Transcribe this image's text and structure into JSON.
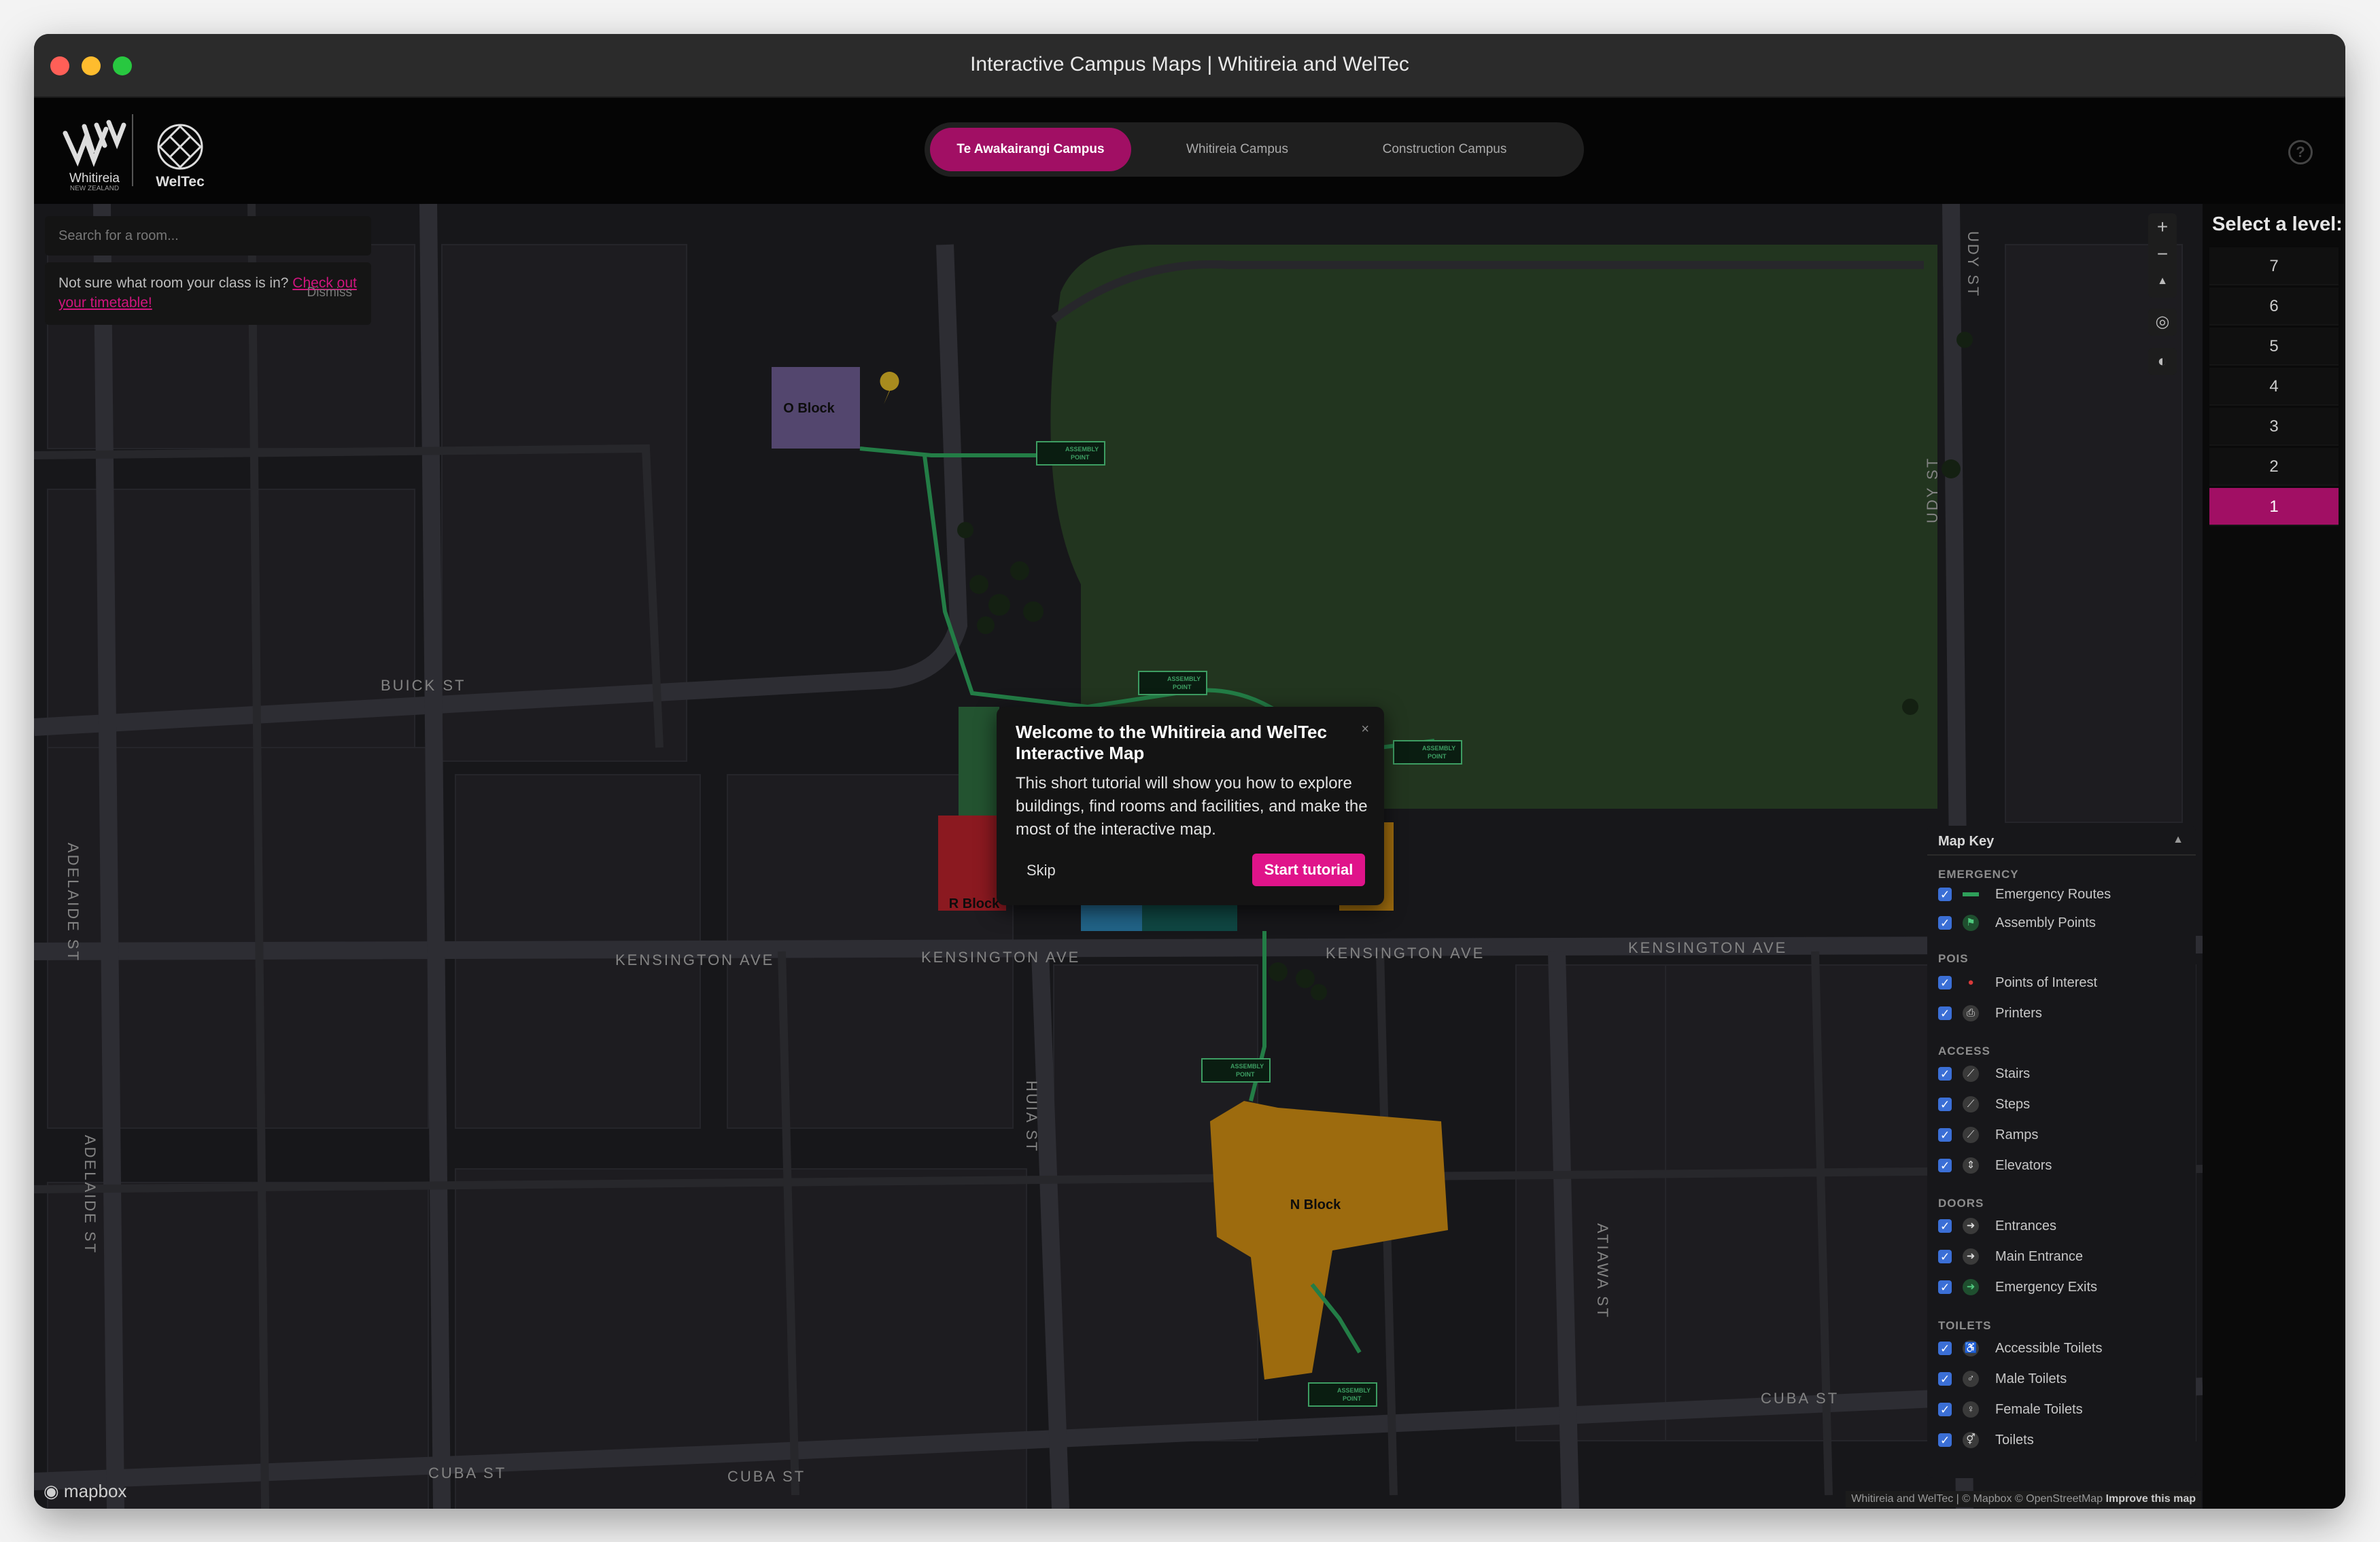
{
  "window": {
    "title": "Interactive Campus Maps | Whitireia and WelTec"
  },
  "header": {
    "logo_whitireia": "Whitireia",
    "logo_whitireia_sub": "NEW ZEALAND",
    "logo_weltec": "WelTec",
    "tabs": [
      {
        "label": "Te Awakairangi Campus",
        "active": true
      },
      {
        "label": "Whitireia Campus",
        "active": false
      },
      {
        "label": "Construction Campus",
        "active": false
      }
    ],
    "help": "?"
  },
  "search": {
    "placeholder": "Search for a room..."
  },
  "tip": {
    "text": "Not sure what room your class is in? ",
    "link": "Check out your timetable!",
    "dismiss": "Dismiss"
  },
  "controls": {
    "zoom_in": "+",
    "zoom_out": "−",
    "compass": "▲",
    "locate": "◎",
    "theme": "◐"
  },
  "levels": {
    "title": "Select a level:",
    "items": [
      "7",
      "6",
      "5",
      "4",
      "3",
      "2",
      "1"
    ],
    "active": "1"
  },
  "map": {
    "streets": [
      "BUICK ST",
      "KENSINGTON AVE",
      "KENSINGTON AVE",
      "KENSINGTON AVE",
      "KENSINGTON AVE",
      "CUBA ST",
      "CUBA ST",
      "CUBA ST",
      "ADELAIDE ST",
      "ADELAIDE ST",
      "HUIA ST",
      "ATIAWA ST",
      "UDY ST",
      "UDY ST"
    ],
    "buildings": [
      "O Block",
      "R Block",
      "N Block"
    ],
    "assembly_label": "ASSEMBLY",
    "assembly_label2": "POINT"
  },
  "modal": {
    "title": "Welcome to the Whitireia and WelTec Interactive Map",
    "body": "This short tutorial will show you how to explore buildings, find rooms and facilities, and make the most of the interactive map.",
    "close": "×",
    "skip": "Skip",
    "start": "Start tutorial"
  },
  "legend": {
    "title": "Map Key",
    "caret": "▲",
    "sections": [
      {
        "name": "EMERGENCY",
        "items": [
          "Emergency Routes",
          "Assembly Points"
        ]
      },
      {
        "name": "POIS",
        "items": [
          "Points of Interest",
          "Printers"
        ]
      },
      {
        "name": "ACCESS",
        "items": [
          "Stairs",
          "Steps",
          "Ramps",
          "Elevators"
        ]
      },
      {
        "name": "DOORS",
        "items": [
          "Entrances",
          "Main Entrance",
          "Emergency Exits"
        ]
      },
      {
        "name": "TOILETS",
        "items": [
          "Accessible Toilets",
          "Male Toilets",
          "Female Toilets",
          "Toilets"
        ]
      }
    ]
  },
  "attribution": {
    "text": "Whitireia and WelTec | © Mapbox © OpenStreetMap ",
    "improve": "Improve this map"
  },
  "mapbox_logo": "mapbox",
  "colors": {
    "accent": "#a10f64",
    "button": "#e0148a",
    "emergency": "#2ea05a",
    "building_o": "#6b5a8e",
    "building_r": "#b3202a",
    "building_n": "#c98a12"
  }
}
